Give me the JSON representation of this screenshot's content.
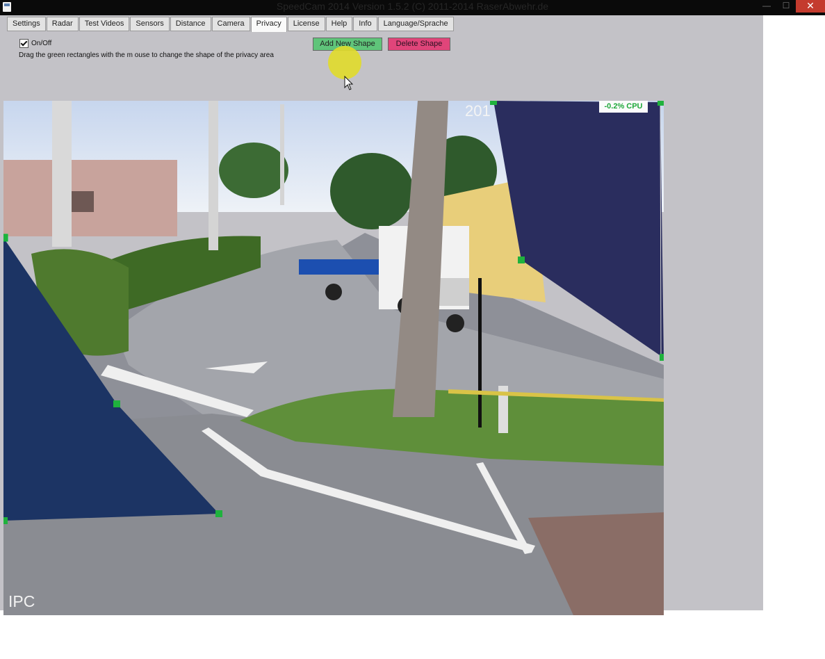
{
  "window": {
    "title": "SpeedCam 2014 Version 1.5.2 (C) 2011-2014 RaserAbwehr.de",
    "min_label": "—",
    "max_label": "☐",
    "close_label": "✕"
  },
  "tabs": [
    {
      "label": "Settings"
    },
    {
      "label": "Radar"
    },
    {
      "label": "Test Videos"
    },
    {
      "label": "Sensors"
    },
    {
      "label": "Distance"
    },
    {
      "label": "Camera"
    },
    {
      "label": "Privacy",
      "active": true
    },
    {
      "label": "License"
    },
    {
      "label": "Help"
    },
    {
      "label": "Info"
    },
    {
      "label": "Language/Sprache"
    }
  ],
  "privacy": {
    "onoff_label": "On/Off",
    "onoff_checked": true,
    "hint": "Drag the green rectangles with the m ouse to change the shape of the privacy area",
    "add_label": "Add New Shape",
    "delete_label": "Delete Shape"
  },
  "video": {
    "cpu_label": "-0.2% CPU",
    "timestamp": "201",
    "camera_label": "IPC"
  },
  "colors": {
    "panel_bg": "#c3c2c7",
    "add_button": "#5fc47a",
    "delete_button": "#e0457a",
    "privacy_shape_left": "#1c3464",
    "privacy_shape_right": "#2a2d5e",
    "handle": "#1fb23d"
  }
}
